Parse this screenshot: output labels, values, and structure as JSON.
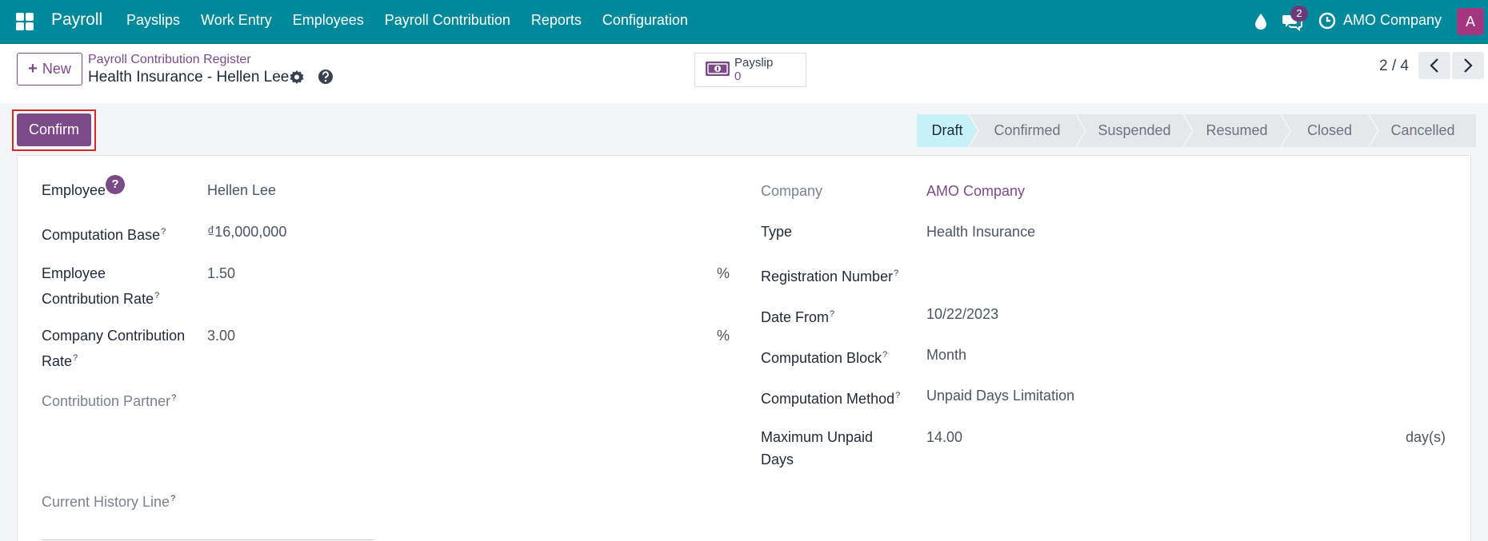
{
  "navbar": {
    "brand": "Payroll",
    "menu": [
      "Payslips",
      "Work Entry",
      "Employees",
      "Payroll Contribution",
      "Reports",
      "Configuration"
    ],
    "chat_count": "2",
    "company": "AMO Company",
    "avatar_letter": "A",
    "color": "#00899b"
  },
  "control": {
    "new_label": "New",
    "breadcrumb": "Payroll Contribution Register",
    "title": "Health Insurance - Hellen Lee",
    "payslip_label": "Payslip",
    "payslip_count": "0",
    "pager": "2 / 4"
  },
  "status": {
    "confirm_label": "Confirm",
    "stages": [
      "Draft",
      "Confirmed",
      "Suspended",
      "Resumed",
      "Closed",
      "Cancelled"
    ],
    "active_stage": "Draft"
  },
  "form": {
    "left": {
      "employee_label": "Employee",
      "employee_value": "Hellen Lee",
      "computation_base_label": "Computation Base",
      "computation_base_value": "₫16,000,000",
      "employee_rate_label_1": "Employee",
      "employee_rate_label_2": "Contribution Rate",
      "employee_rate_value": "1.50",
      "company_rate_label_1": "Company Contribution",
      "company_rate_label_2": "Rate",
      "company_rate_value": "3.00",
      "percent": "%",
      "partner_label": "Contribution Partner",
      "history_label": "Current History Line"
    },
    "right": {
      "company_label": "Company",
      "company_value": "AMO Company",
      "type_label": "Type",
      "type_value": "Health Insurance",
      "registration_label": "Registration Number",
      "date_from_label": "Date From",
      "date_from_value": "10/22/2023",
      "block_label": "Computation Block",
      "block_value": "Month",
      "method_label": "Computation Method",
      "method_value": "Unpaid Days Limitation",
      "max_unpaid_label_1": "Maximum Unpaid",
      "max_unpaid_label_2": "Days",
      "max_unpaid_value": "14.00",
      "days_unit": "day(s)"
    },
    "sup": "?",
    "badge": "?"
  },
  "colors": {
    "accent": "#7b4b87",
    "highlight": "#d62828",
    "active_stage": "#c6f1f7"
  }
}
